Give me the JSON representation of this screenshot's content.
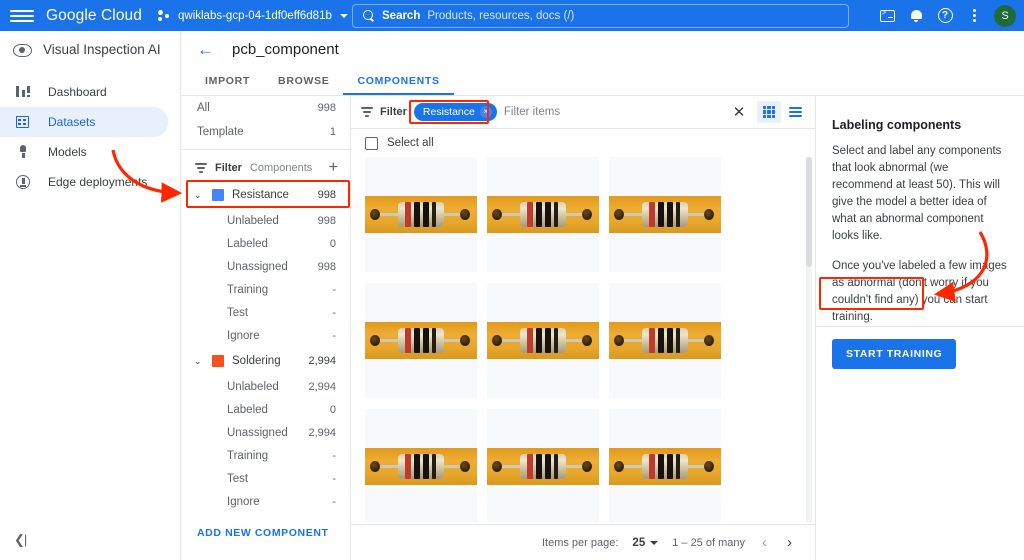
{
  "topbar": {
    "menu_icon": "hamburger-icon",
    "logo_bold": "Google",
    "logo_light": " Cloud",
    "project": "qwiklabs-gcp-04-1df0eff6d81b",
    "search_label": "Search",
    "search_placeholder": "Products, resources, docs (/)",
    "icons": [
      "cloud-shell-icon",
      "notifications-bell-icon",
      "help-icon",
      "more-options-icon"
    ],
    "avatar_initial": "S"
  },
  "rail": {
    "product_title": "Visual Inspection AI",
    "items": [
      {
        "label": "Dashboard",
        "icon": "dashboard-icon"
      },
      {
        "label": "Datasets",
        "icon": "datasets-icon"
      },
      {
        "label": "Models",
        "icon": "models-icon"
      },
      {
        "label": "Edge deployments",
        "icon": "edge-deployments-icon"
      }
    ],
    "selected": "Datasets",
    "collapse_glyph": "❮|"
  },
  "page": {
    "back_glyph": "←",
    "title": "pcb_component",
    "tabs": [
      {
        "label": "IMPORT",
        "active": false
      },
      {
        "label": "BROWSE",
        "active": false
      },
      {
        "label": "COMPONENTS",
        "active": true
      }
    ]
  },
  "components_panel": {
    "summary": [
      {
        "label": "All",
        "count": "998"
      },
      {
        "label": "Template",
        "count": "1"
      }
    ],
    "filter_label": "Filter",
    "filter_sub": "Components",
    "add_icon": "+",
    "groups": [
      {
        "name": "Resistance",
        "count": "998",
        "color": "#4285f4",
        "chevron": "⌄",
        "children": [
          {
            "label": "Unlabeled",
            "count": "998"
          },
          {
            "label": "Labeled",
            "count": "0"
          },
          {
            "label": "Unassigned",
            "count": "998"
          },
          {
            "label": "Training",
            "count": "-"
          },
          {
            "label": "Test",
            "count": "-"
          },
          {
            "label": "Ignore",
            "count": "-"
          }
        ]
      },
      {
        "name": "Soldering",
        "count": "2,994",
        "color": "#f4511e",
        "chevron": "⌄",
        "children": [
          {
            "label": "Unlabeled",
            "count": "2,994"
          },
          {
            "label": "Labeled",
            "count": "0"
          },
          {
            "label": "Unassigned",
            "count": "2,994"
          },
          {
            "label": "Training",
            "count": "-"
          },
          {
            "label": "Test",
            "count": "-"
          },
          {
            "label": "Ignore",
            "count": "-"
          }
        ]
      }
    ],
    "add_new_component": "ADD NEW COMPONENT"
  },
  "filter_bar": {
    "label": "Filter",
    "chip": {
      "text": "Resistance",
      "remove_glyph": "×"
    },
    "items_placeholder": "Filter items",
    "clear_glyph": "✕",
    "grid_view": "grid-view-icon",
    "list_view": "list-view-icon",
    "active_view": "grid"
  },
  "gallery": {
    "select_all_label": "Select all",
    "rows": [
      [
        "resistor-thumbnail",
        "resistor-thumbnail",
        "resistor-thumbnail"
      ],
      [
        "resistor-thumbnail",
        "resistor-thumbnail",
        "resistor-thumbnail"
      ],
      [
        "resistor-thumbnail",
        "resistor-thumbnail",
        "resistor-thumbnail"
      ]
    ]
  },
  "pagination": {
    "items_per_page_label": "Items per page:",
    "items_per_page_value": "25",
    "range": "1 – 25 of many",
    "prev_glyph": "‹",
    "next_glyph": "›"
  },
  "help_panel": {
    "title": "Labeling components",
    "paragraph1": "Select and label any components that look abnormal (we recommend at least 50). This will give the model a better idea of what an abnormal component looks like.",
    "paragraph2": "Once you've labeled a few images as abnormal (don't worry if you couldn't find any) you can start training.",
    "start_training_label": "START TRAINING"
  },
  "annotations": {
    "highlight_color": "#ff2600",
    "highlights": [
      "resistance-group-row",
      "resistance-filter-chip",
      "start-training-button"
    ],
    "arrows": [
      "arrow-to-resistance-group",
      "arrow-to-start-training"
    ]
  }
}
